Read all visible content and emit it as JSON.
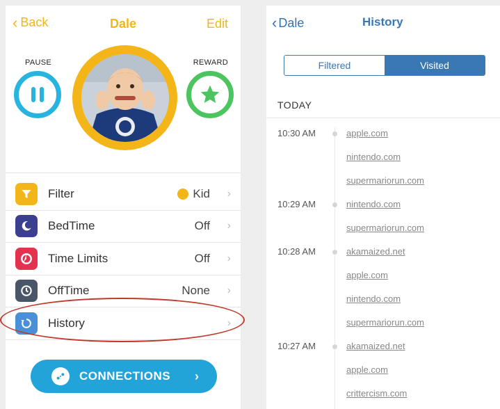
{
  "left": {
    "header": {
      "back_label": "Back",
      "title": "Dale",
      "edit_label": "Edit"
    },
    "controls": {
      "pause_label": "PAUSE",
      "reward_label": "REWARD"
    },
    "settings": [
      {
        "label": "Filter",
        "value": "Kid",
        "icon": "filter-icon",
        "color": "#f3b618"
      },
      {
        "label": "BedTime",
        "value": "Off",
        "icon": "moon-icon",
        "color": "#3b3f8f"
      },
      {
        "label": "Time Limits",
        "value": "Off",
        "icon": "time-limit-icon",
        "color": "#e2324f"
      },
      {
        "label": "OffTime",
        "value": "None",
        "icon": "clock-icon",
        "color": "#4a5568"
      },
      {
        "label": "History",
        "value": "",
        "icon": "history-icon",
        "color": "#4a90d9"
      }
    ],
    "connections_label": "CONNECTIONS"
  },
  "right": {
    "header": {
      "back_label": "Dale",
      "title": "History"
    },
    "segments": {
      "filtered": "Filtered",
      "visited": "Visited",
      "selected": "Visited"
    },
    "section_label": "TODAY",
    "entries": [
      {
        "time": "10:30 AM",
        "site": "apple.com"
      },
      {
        "time": "",
        "site": "nintendo.com"
      },
      {
        "time": "",
        "site": "supermariorun.com"
      },
      {
        "time": "10:29 AM",
        "site": "nintendo.com"
      },
      {
        "time": "",
        "site": "supermariorun.com"
      },
      {
        "time": "10:28 AM",
        "site": "akamaized.net"
      },
      {
        "time": "",
        "site": "apple.com"
      },
      {
        "time": "",
        "site": "nintendo.com"
      },
      {
        "time": "",
        "site": "supermariorun.com"
      },
      {
        "time": "10:27 AM",
        "site": "akamaized.net"
      },
      {
        "time": "",
        "site": "apple.com"
      },
      {
        "time": "",
        "site": "crittercism.com"
      }
    ]
  },
  "colors": {
    "accent_yellow": "#f3b618",
    "accent_blue": "#22a4d9",
    "pause_blue": "#27b5e0",
    "reward_green": "#4cc45f",
    "nav_blue": "#3a78b3",
    "annotation_red": "#c0392b"
  }
}
